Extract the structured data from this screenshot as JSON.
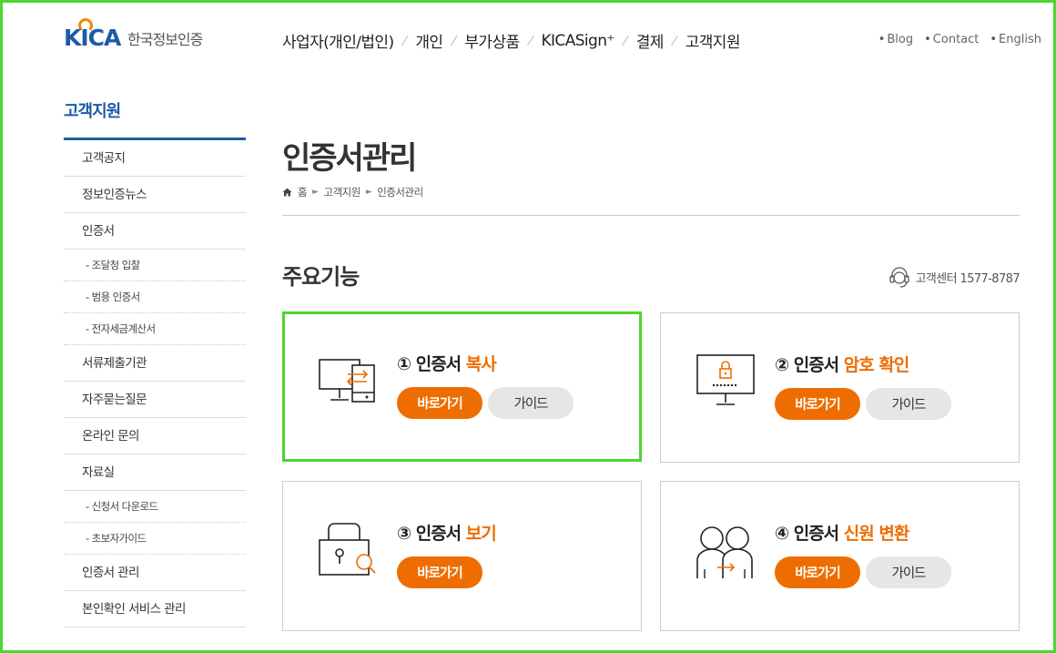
{
  "header": {
    "logo_text": "KICA",
    "logo_name": "한국정보인증",
    "nav": [
      "사업자(개인/법인)",
      "개인",
      "부가상품",
      "KICASign⁺",
      "결제",
      "고객지원"
    ],
    "nav_separator": "⁄",
    "util": [
      "Blog",
      "Contact",
      "English"
    ]
  },
  "sidebar": {
    "title": "고객지원",
    "items": [
      {
        "label": "고객공지",
        "sub": false
      },
      {
        "label": "정보인증뉴스",
        "sub": false
      },
      {
        "label": "인증서",
        "sub": false
      },
      {
        "label": "조달청 입찰",
        "sub": true
      },
      {
        "label": "범용 인증서",
        "sub": true
      },
      {
        "label": "전자세금계산서",
        "sub": true
      },
      {
        "label": "서류제출기관",
        "sub": false
      },
      {
        "label": "자주묻는질문",
        "sub": false
      },
      {
        "label": "온라인 문의",
        "sub": false
      },
      {
        "label": "자료실",
        "sub": false
      },
      {
        "label": "신청서 다운로드",
        "sub": true
      },
      {
        "label": "초보자가이드",
        "sub": true
      },
      {
        "label": "인증서 관리",
        "sub": false
      },
      {
        "label": "본인확인 서비스 관리",
        "sub": false
      }
    ]
  },
  "main": {
    "page_title": "인증서관리",
    "breadcrumb": [
      "홈",
      "고객지원",
      "인증서관리"
    ],
    "section_title": "주요기능",
    "support_center": "고객센터 1577-8787",
    "cards": [
      {
        "num": "①",
        "title": "인증서",
        "highlight": "복사",
        "go_label": "바로가기",
        "guide_label": "가이드",
        "icon": "monitor-transfer-icon"
      },
      {
        "num": "②",
        "title": "인증서",
        "highlight": "암호 확인",
        "go_label": "바로가기",
        "guide_label": "가이드",
        "icon": "monitor-lock-icon"
      },
      {
        "num": "③",
        "title": "인증서",
        "highlight": "보기",
        "go_label": "바로가기",
        "guide_label": "",
        "icon": "lock-search-icon"
      },
      {
        "num": "④",
        "title": "인증서",
        "highlight": "신원 변환",
        "go_label": "바로가기",
        "guide_label": "가이드",
        "icon": "people-transfer-icon"
      }
    ]
  },
  "colors": {
    "brand_blue": "#1e5aa8",
    "accent_orange": "#ee6d00",
    "highlight_green": "#4cd62e"
  }
}
